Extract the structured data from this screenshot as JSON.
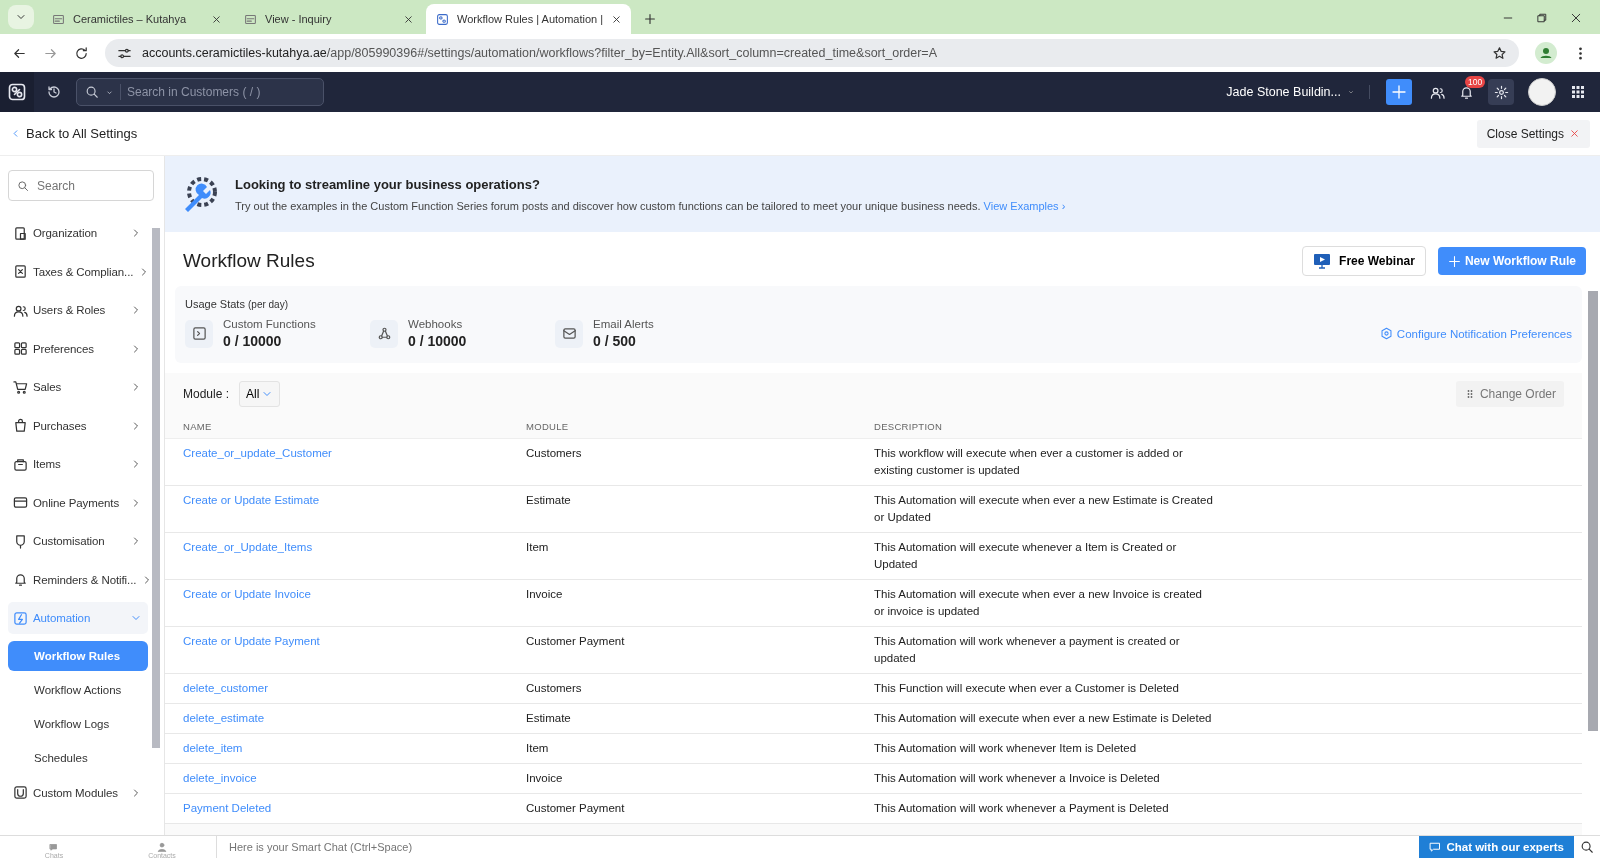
{
  "browser": {
    "tabs": [
      {
        "title": "Ceramictiles – Kutahya",
        "selected": false
      },
      {
        "title": "View - Inquiry",
        "selected": false
      },
      {
        "title": "Workflow Rules | Automation |",
        "selected": true
      }
    ],
    "url_host": "accounts.ceramictiles-kutahya.ae",
    "url_path": "/app/805990396#/settings/automation/workflows?filter_by=Entity.All&sort_column=created_time&sort_order=A"
  },
  "header": {
    "search_placeholder": "Search in Customers ( / )",
    "org": "Jade Stone Buildin...",
    "notification_count": "100"
  },
  "back_link": "Back to All Settings",
  "close_settings": "Close Settings",
  "sidebar": {
    "search_placeholder": "Search",
    "items": [
      {
        "label": "Organization",
        "expanded": false
      },
      {
        "label": "Taxes & Complian...",
        "expanded": false
      },
      {
        "label": "Users & Roles",
        "expanded": false
      },
      {
        "label": "Preferences",
        "expanded": false
      },
      {
        "label": "Sales",
        "expanded": false
      },
      {
        "label": "Purchases",
        "expanded": false
      },
      {
        "label": "Items",
        "expanded": false
      },
      {
        "label": "Online Payments",
        "expanded": false
      },
      {
        "label": "Customisation",
        "expanded": false
      },
      {
        "label": "Reminders & Notifi...",
        "expanded": false
      },
      {
        "label": "Automation",
        "expanded": true,
        "children": [
          {
            "label": "Workflow Rules",
            "selected": true
          },
          {
            "label": "Workflow Actions",
            "selected": false
          },
          {
            "label": "Workflow Logs",
            "selected": false
          },
          {
            "label": "Schedules",
            "selected": false
          }
        ]
      },
      {
        "label": "Custom Modules",
        "expanded": false
      }
    ]
  },
  "banner": {
    "title": "Looking to streamline your business operations?",
    "text": "Try out the examples in the Custom Function Series forum posts and discover how custom functions can be tailored to meet your unique business needs.",
    "link": "View Examples ›"
  },
  "page_title": "Workflow Rules",
  "free_webinar": "Free Webinar",
  "new_rule": "New Workflow Rule",
  "usage": {
    "title": "Usage Stats",
    "title_note": "(per day)",
    "stats": [
      {
        "label": "Custom Functions",
        "value": "0 / 10000"
      },
      {
        "label": "Webhooks",
        "value": "0 / 10000"
      },
      {
        "label": "Email Alerts",
        "value": "0 / 500"
      }
    ],
    "configure": "Configure Notification Preferences"
  },
  "filter": {
    "label": "Module :",
    "value": "All"
  },
  "change_order": "Change Order",
  "table": {
    "columns": [
      "NAME",
      "MODULE",
      "DESCRIPTION"
    ],
    "rows": [
      [
        "Create_or_update_Customer",
        "Customers",
        "This workflow will execute when ever a customer is added or existing customer is updated"
      ],
      [
        "Create or Update Estimate",
        "Estimate",
        "This Automation will execute when ever a new Estimate is Created or Updated"
      ],
      [
        "Create_or_Update_Items",
        "Item",
        "This Automation will execute whenever a Item is Created or Updated"
      ],
      [
        "Create or Update Invoice",
        "Invoice",
        "This Automation will execute when ever a new Invoice is created or invoice is updated"
      ],
      [
        "Create or Update Payment",
        "Customer Payment",
        "This Automation will work whenever a payment is created or updated"
      ],
      [
        "delete_customer",
        "Customers",
        "This Function will execute when ever a Customer is Deleted"
      ],
      [
        "delete_estimate",
        "Estimate",
        "This Automation will execute when ever a new Estimate is Deleted"
      ],
      [
        "delete_item",
        "Item",
        "This Automation will work whenever Item is Deleted"
      ],
      [
        "delete_invoice",
        "Invoice",
        "This Automation will work whenever a Invoice is Deleted"
      ],
      [
        "Payment Deleted",
        "Customer Payment",
        "This Automation will work whenever a Payment is Deleted"
      ]
    ]
  },
  "bottom_bar": {
    "chats": "Chats",
    "contacts": "Contacts",
    "chat_placeholder": "Here is your Smart Chat (Ctrl+Space)",
    "experts": "Chat with our experts"
  }
}
